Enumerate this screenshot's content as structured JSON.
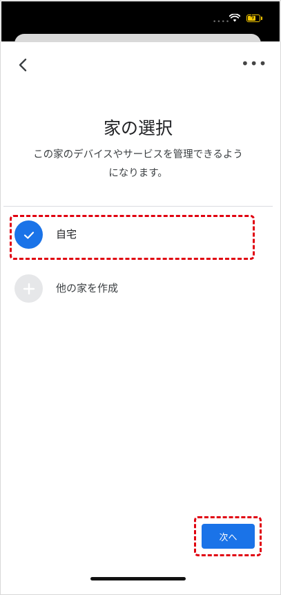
{
  "status_bar": {
    "signal_icon": "signal-dots-icon",
    "wifi_icon": "wifi-icon",
    "battery_icon": "battery-charging-icon",
    "battery_color": "#f5c800"
  },
  "header": {
    "back_icon": "chevron-left-icon",
    "more_icon": "more-horizontal-icon",
    "more_glyph": "•••"
  },
  "page": {
    "title": "家の選択",
    "subtitle_line1": "この家のデバイスやサービスを管理できるよう",
    "subtitle_line2": "になります。"
  },
  "homes": [
    {
      "label": "自宅",
      "selected": true,
      "icon": "check-icon"
    },
    {
      "label": "他の家を作成",
      "selected": false,
      "icon": "plus-icon"
    }
  ],
  "footer": {
    "next_label": "次へ"
  },
  "colors": {
    "accent": "#1a73e8",
    "highlight": "#e0000f",
    "add_circle": "#e6e7e9"
  }
}
